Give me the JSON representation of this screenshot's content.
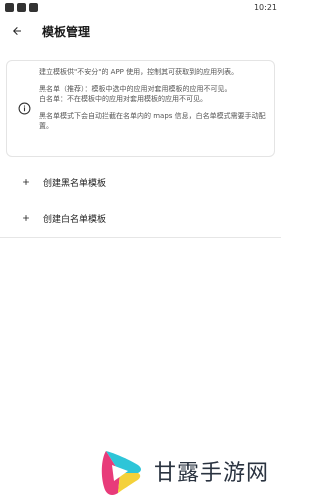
{
  "status_bar": {
    "time": "10:21"
  },
  "header": {
    "title": "模板管理"
  },
  "info_card": {
    "line1": "建立模板供\"不安分\"的 APP 使用，控制其可获取到的应用列表。",
    "line2": "黑名单（推荐）：模板中选中的应用对套用模板的应用不可见。",
    "line3": "白名单：不在模板中的应用对套用模板的应用不可见。",
    "line4": "黑名单模式下会自动拦截在名单内的 maps 信息，白名单模式需要手动配置。"
  },
  "menu": {
    "create_blacklist": "创建黑名单模板",
    "create_whitelist": "创建白名单模板"
  },
  "watermark": {
    "text": "甘露手游网"
  },
  "icons": {
    "back": "arrow-left-icon",
    "info": "info-circle-icon",
    "add": "plus-icon"
  }
}
